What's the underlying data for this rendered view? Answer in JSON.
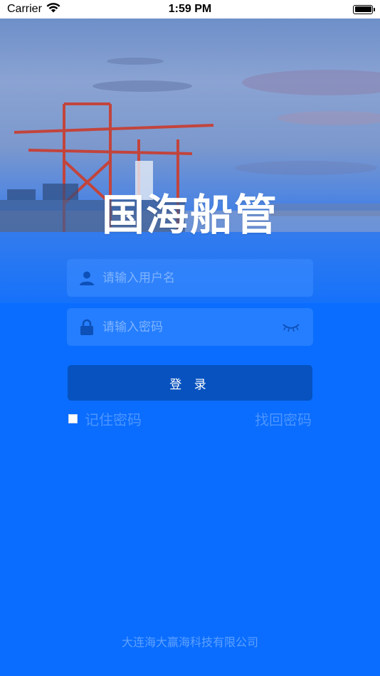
{
  "status_bar": {
    "carrier": "Carrier",
    "time": "1:59 PM",
    "wifi_icon": "wifi-icon",
    "battery_icon": "battery-icon"
  },
  "app": {
    "title": "国海船管"
  },
  "login_form": {
    "username_placeholder": "请输入用户名",
    "password_placeholder": "请输入密码",
    "username_icon": "user-icon",
    "password_icon": "lock-icon",
    "password_toggle_icon": "eye-closed-icon",
    "submit_label": "登 录",
    "remember_label": "记住密码",
    "remember_checked": false,
    "forgot_label": "找回密码"
  },
  "footer": {
    "company": "大连海大赢海科技有限公司"
  },
  "colors": {
    "background": "#0a6dff",
    "button": "#0752bf",
    "field": "#3c8cff",
    "link_text": "#4d95ff"
  }
}
